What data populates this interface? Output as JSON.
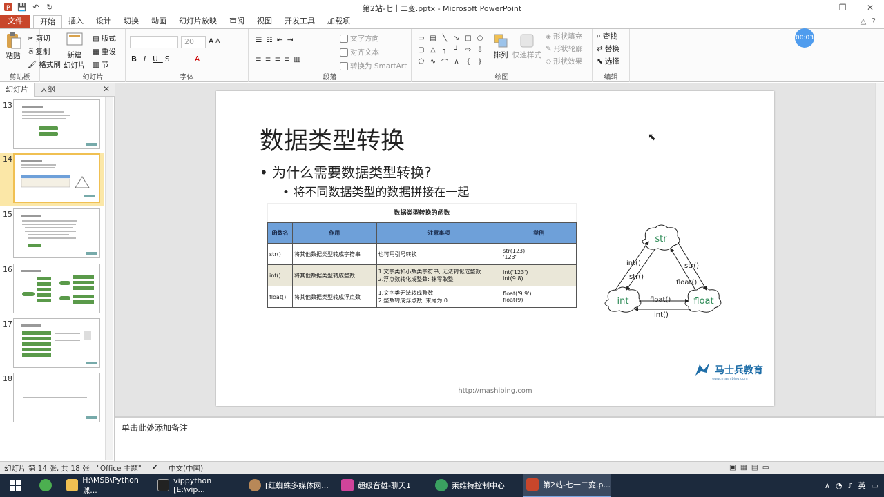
{
  "window": {
    "title": "第2站-七十二变.pptx - Microsoft PowerPoint"
  },
  "qat": {
    "save": "💾",
    "undo": "↶",
    "redo": "↻"
  },
  "tabs": [
    {
      "label": "文件"
    },
    {
      "label": "开始"
    },
    {
      "label": "插入"
    },
    {
      "label": "设计"
    },
    {
      "label": "切换"
    },
    {
      "label": "动画"
    },
    {
      "label": "幻灯片放映"
    },
    {
      "label": "审阅"
    },
    {
      "label": "视图"
    },
    {
      "label": "开发工具"
    },
    {
      "label": "加载项"
    }
  ],
  "ribbon": {
    "clipboard": {
      "label": "剪贴板",
      "paste": "粘贴",
      "cut": "剪切",
      "copy": "复制",
      "format_painter": "格式刷"
    },
    "slides": {
      "label": "幻灯片",
      "new_slide": "新建",
      "new_slide2": "幻灯片",
      "layout": "版式",
      "reset": "重设",
      "section": "节"
    },
    "font": {
      "label": "字体",
      "size": "20"
    },
    "paragraph": {
      "label": "段落",
      "text_direction": "文字方向",
      "align_text": "对齐文本",
      "smartart": "转换为 SmartArt"
    },
    "drawing": {
      "label": "绘图",
      "arrange": "排列",
      "quick_styles": "快速样式",
      "shape_fill": "形状填充",
      "shape_outline": "形状轮廓",
      "shape_effects": "形状效果"
    },
    "editing": {
      "label": "编辑",
      "find": "查找",
      "replace": "替换",
      "select": "选择"
    }
  },
  "timer": "00:03",
  "left_panel": {
    "tabs": [
      "幻灯片",
      "大纲"
    ],
    "thumbs": [
      {
        "num": "13"
      },
      {
        "num": "14"
      },
      {
        "num": "15"
      },
      {
        "num": "16"
      },
      {
        "num": "17"
      },
      {
        "num": "18"
      }
    ]
  },
  "slide": {
    "title": "数据类型转换",
    "bullet1": "为什么需要数据类型转换?",
    "bullet2": "将不同数据类型的数据拼接在一起",
    "table_caption": "数据类型转换的函数",
    "headers": [
      "函数名",
      "作用",
      "注意事项",
      "举例"
    ],
    "rows": [
      {
        "fn": "str()",
        "role": "将其他数据类型转成字符串",
        "note1": "也可用引号转换",
        "note2": "",
        "ex1": "str(123)",
        "ex2": "'123'"
      },
      {
        "fn": "int()",
        "role": "将其他数据类型转成整数",
        "note1": "1.文字类和小数类字符串, 无法转化成整数",
        "note2": "2.浮点数转化成整数: 抹零取整",
        "ex1": "int('123')",
        "ex2": "int(9.8)"
      },
      {
        "fn": "float()",
        "role": "将其他数据类型转成浮点数",
        "note1": "1.文字类无法转成整数",
        "note2": "2.整数转成浮点数, 末尾为.0",
        "ex1": "float('9.9')",
        "ex2": "float(9)"
      }
    ],
    "diagram": {
      "nodes": [
        "str",
        "int",
        "float"
      ],
      "edges": [
        "int()",
        "str()",
        "str()",
        "float()",
        "float()",
        "int()"
      ]
    },
    "logo": "马士兵教育",
    "logo_sub": "www.mashibing.com",
    "url": "http://mashibing.com"
  },
  "notes": {
    "placeholder": "单击此处添加备注"
  },
  "status": {
    "slide_info": "幻灯片 第 14 张, 共 18 张",
    "theme": "\"Office 主题\"",
    "language": "中文(中国)"
  },
  "taskbar": {
    "items": [
      {
        "label": "H:\\MSB\\Python课..."
      },
      {
        "label": "vippython [E:\\vip..."
      },
      {
        "label": "[红蜘蛛多媒体网..."
      },
      {
        "label": "超级音雄-聊天1"
      },
      {
        "label": "莱维特控制中心"
      },
      {
        "label": "第2站-七十二变.p..."
      }
    ],
    "ime": "英"
  },
  "colors": {
    "file_tab": "#c8462b",
    "table_header": "#6ea0d9",
    "alt_row": "#eae7d8",
    "selected_thumb": "#fbe7a7",
    "taskbar": "#1c2a3d"
  }
}
